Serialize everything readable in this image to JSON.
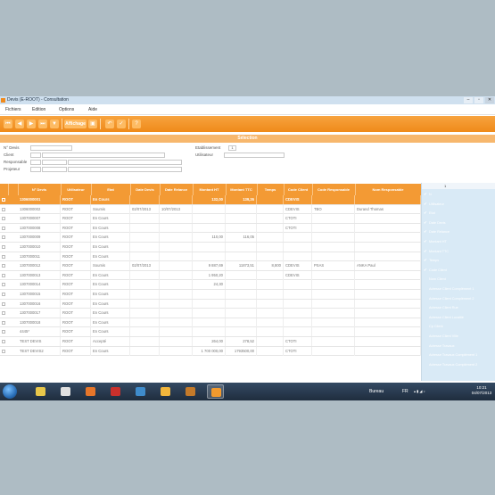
{
  "window": {
    "title": "Devis (E-ROOT) - Consultation"
  },
  "menu": [
    "Fichiers",
    "Edition",
    "Options",
    "Aide"
  ],
  "toolbar": {
    "nav": [
      "⏮",
      "◀",
      "▶",
      "⏭",
      "▼"
    ],
    "affichage_label": "Affichage",
    "actions": [
      "↶",
      "✓",
      "?"
    ]
  },
  "selection": {
    "header": "Sélection",
    "fields": {
      "no_devis": "N° Devis",
      "client": "Client",
      "responsable": "Responsable",
      "projeteur": "Projeteur",
      "etablissement": "Etablissement",
      "etablissement_value": "1",
      "utilisateur": "Utilisateur"
    }
  },
  "grid": {
    "columns": [
      "",
      "N° Devis",
      "Utilisateur",
      "Etat",
      "Date Devis",
      "Date Relance",
      "Montant HT",
      "Montant TTC",
      "Temps",
      "Code Client",
      "Code Responsable",
      "Nom Responsable"
    ],
    "rows": [
      {
        "selected": true,
        "cells": [
          "1306000001",
          "ROOT",
          "En Cours",
          "",
          "",
          "132,00",
          "139,26",
          "",
          "CDEVIS",
          "",
          ""
        ]
      },
      {
        "cells": [
          "1306000002",
          "ROOT",
          "Soumis",
          "02/07/2013",
          "10/07/2013",
          "",
          "",
          "",
          "CDEVIS",
          "TBO",
          "Durand Thomas"
        ]
      },
      {
        "cells": [
          "1307000007",
          "ROOT",
          "En Cours",
          "",
          "",
          "",
          "",
          "",
          "CTOTI",
          "",
          ""
        ]
      },
      {
        "cells": [
          "1307000008",
          "ROOT",
          "En Cours",
          "",
          "",
          "",
          "",
          "",
          "CTOTI",
          "",
          ""
        ]
      },
      {
        "cells": [
          "1307000009",
          "ROOT",
          "En Cours",
          "",
          "",
          "110,00",
          "116,05",
          "",
          "",
          "",
          ""
        ]
      },
      {
        "cells": [
          "1307000010",
          "ROOT",
          "En Cours",
          "",
          "",
          "",
          "",
          "",
          "",
          "",
          ""
        ]
      },
      {
        "cells": [
          "1307000011",
          "ROOT",
          "En Cours",
          "",
          "",
          "",
          "",
          "",
          "",
          "",
          ""
        ]
      },
      {
        "cells": [
          "1307000012",
          "ROOT",
          "Soumis",
          "02/07/2013",
          "",
          "9 887,69",
          "11873,51",
          "8,800",
          "CDEVIS",
          "PSAS",
          "ANKA Paul"
        ]
      },
      {
        "cells": [
          "1307000013",
          "ROOT",
          "En Cours",
          "",
          "",
          "1 950,20",
          "",
          "",
          "CDEVIS",
          "",
          ""
        ]
      },
      {
        "cells": [
          "1307000014",
          "ROOT",
          "En Cours",
          "",
          "",
          "24,30",
          "",
          "",
          "",
          "",
          ""
        ]
      },
      {
        "cells": [
          "1307000015",
          "ROOT",
          "En Cours",
          "",
          "",
          "",
          "",
          "",
          "",
          "",
          ""
        ]
      },
      {
        "cells": [
          "1307000016",
          "ROOT",
          "En Cours",
          "",
          "",
          "",
          "",
          "",
          "",
          "",
          ""
        ]
      },
      {
        "cells": [
          "1307000017",
          "ROOT",
          "En Cours",
          "",
          "",
          "",
          "",
          "",
          "",
          "",
          ""
        ]
      },
      {
        "cells": [
          "1307000018",
          "ROOT",
          "En Cours",
          "",
          "",
          "",
          "",
          "",
          "",
          "",
          ""
        ]
      },
      {
        "cells": [
          "4445*",
          "ROOT",
          "En Cours",
          "",
          "",
          "",
          "",
          "",
          "",
          "",
          ""
        ]
      },
      {
        "cells": [
          "TEST DEVIS",
          "ROOT",
          "Accepté",
          "",
          "",
          "264,00",
          "278,52",
          "",
          "CTOTI",
          "",
          ""
        ]
      },
      {
        "cells": [
          "TEST DEVIS2",
          "ROOT",
          "En Cours",
          "",
          "",
          "1 700 000,00",
          "1793500,00",
          "",
          "CTOTI",
          "",
          ""
        ]
      }
    ]
  },
  "sidepanel": {
    "number": "1",
    "items": [
      {
        "label": "N",
        "checked": true
      },
      {
        "label": "Utilisateur",
        "checked": true
      },
      {
        "label": "Etat",
        "checked": true
      },
      {
        "label": "Date Devis",
        "checked": true
      },
      {
        "label": "Date Relance",
        "checked": true
      },
      {
        "label": "Montant HT",
        "checked": true
      },
      {
        "label": "Montant TTC",
        "checked": true
      },
      {
        "label": "Temps",
        "checked": true
      },
      {
        "label": "Code Client",
        "checked": true
      },
      {
        "label": "Nom Client",
        "checked": false
      },
      {
        "label": "Adresse Client Complément 1",
        "checked": false
      },
      {
        "label": "Adresse Client Complément 2",
        "checked": false
      },
      {
        "label": "Adresse Client Rue",
        "checked": false
      },
      {
        "label": "Adresse Client Localité",
        "checked": false
      },
      {
        "label": "Cp Client",
        "checked": false
      },
      {
        "label": "Adresse Client Ville",
        "checked": false
      },
      {
        "label": "Adresse Travaux",
        "checked": false
      },
      {
        "label": "Adresse Travaux Complément 1",
        "checked": false
      },
      {
        "label": "Adresse Travaux Complément 2",
        "checked": false
      }
    ]
  },
  "taskbar": {
    "apps": [
      "explorer",
      "media-player",
      "firefox",
      "pdf-reader",
      "spreadsheet",
      "outlook",
      "app-icons",
      "app-active"
    ],
    "bureau": "Bureau",
    "lang": "FR",
    "time": "10:21",
    "date": "04/07/2013"
  },
  "colors": {
    "accent": "#f39a34",
    "panel": "#d9eaf6",
    "taskbar": "#263648"
  }
}
